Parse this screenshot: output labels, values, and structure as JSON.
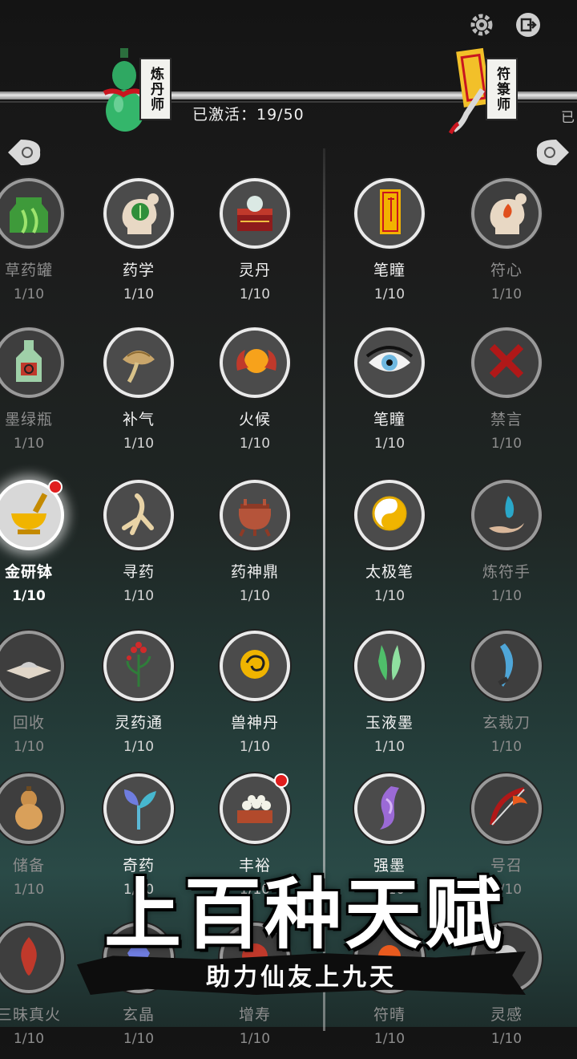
{
  "header": {
    "left_class": "炼丹师",
    "right_class": "符箓师",
    "activated_text": "已激活：19/50",
    "right_edge_fragment": "已"
  },
  "left_talents": [
    {
      "name": "草药罐",
      "level": "1/10",
      "state": "dim",
      "icon": "herb-jar-icon"
    },
    {
      "name": "药学",
      "level": "1/10",
      "state": "normal",
      "icon": "herb-mind-icon"
    },
    {
      "name": "灵丹",
      "level": "1/10",
      "state": "normal",
      "icon": "elixir-box-icon"
    },
    {
      "name": "墨绿瓶",
      "level": "1/10",
      "state": "dim",
      "icon": "green-bottle-icon"
    },
    {
      "name": "补气",
      "level": "1/10",
      "state": "normal",
      "icon": "lingzhi-icon"
    },
    {
      "name": "火候",
      "level": "1/10",
      "state": "normal",
      "icon": "fire-orb-icon"
    },
    {
      "name": "金研钵",
      "level": "1/10",
      "state": "active",
      "icon": "gold-mortar-icon",
      "dot": true
    },
    {
      "name": "寻药",
      "level": "1/10",
      "state": "normal",
      "icon": "ginseng-icon"
    },
    {
      "name": "药神鼎",
      "level": "1/10",
      "state": "normal",
      "icon": "cauldron-icon"
    },
    {
      "name": "回收",
      "level": "1/10",
      "state": "dim",
      "icon": "powder-icon"
    },
    {
      "name": "灵药通",
      "level": "1/10",
      "state": "normal",
      "icon": "red-berry-plant-icon"
    },
    {
      "name": "兽神丹",
      "level": "1/10",
      "state": "normal",
      "icon": "beast-pill-icon"
    },
    {
      "name": "储备",
      "level": "1/10",
      "state": "dim",
      "icon": "gourd-icon"
    },
    {
      "name": "奇药",
      "level": "1/10",
      "state": "normal",
      "icon": "blue-sprout-icon"
    },
    {
      "name": "丰裕",
      "level": "1/10",
      "state": "normal",
      "icon": "pill-tray-icon",
      "dot": true
    },
    {
      "name": "三昧真火",
      "level": "1/10",
      "state": "dim",
      "icon": "true-fire-icon"
    },
    {
      "name": "玄晶",
      "level": "1/10",
      "state": "dim",
      "icon": "crystal-icon"
    },
    {
      "name": "增寿",
      "level": "1/10",
      "state": "dim",
      "icon": "longevity-icon"
    }
  ],
  "right_talents": [
    {
      "name": "笔瞳",
      "level": "1/10",
      "state": "normal",
      "icon": "talisman-paper-icon"
    },
    {
      "name": "符心",
      "level": "1/10",
      "state": "dim",
      "icon": "fire-mind-icon"
    },
    {
      "name": "笔瞳",
      "level": "1/10",
      "state": "normal",
      "icon": "eye-icon"
    },
    {
      "name": "禁言",
      "level": "1/10",
      "state": "dim",
      "icon": "red-x-icon"
    },
    {
      "name": "太极笔",
      "level": "1/10",
      "state": "normal",
      "icon": "taiji-icon"
    },
    {
      "name": "炼符手",
      "level": "1/10",
      "state": "dim",
      "icon": "flame-hand-icon"
    },
    {
      "name": "玉液墨",
      "level": "1/10",
      "state": "normal",
      "icon": "jade-ink-icon"
    },
    {
      "name": "玄裁刀",
      "level": "1/10",
      "state": "dim",
      "icon": "blue-blade-icon"
    },
    {
      "name": "强墨",
      "level": "1/10",
      "state": "normal",
      "icon": "purple-ink-icon"
    },
    {
      "name": "号召",
      "level": "1/10",
      "state": "dim",
      "icon": "flame-bow-icon"
    },
    {
      "name": "符晴",
      "level": "1/10",
      "state": "dim",
      "icon": "sun-talisman-icon"
    },
    {
      "name": "灵感",
      "level": "1/10",
      "state": "dim",
      "icon": "inspiration-icon"
    }
  ],
  "overlay": {
    "slogan": "上百种天赋",
    "subtitle": "助力仙友上九天"
  },
  "colors": {
    "accent_red": "#e01e1e",
    "gold": "#f0b400"
  }
}
